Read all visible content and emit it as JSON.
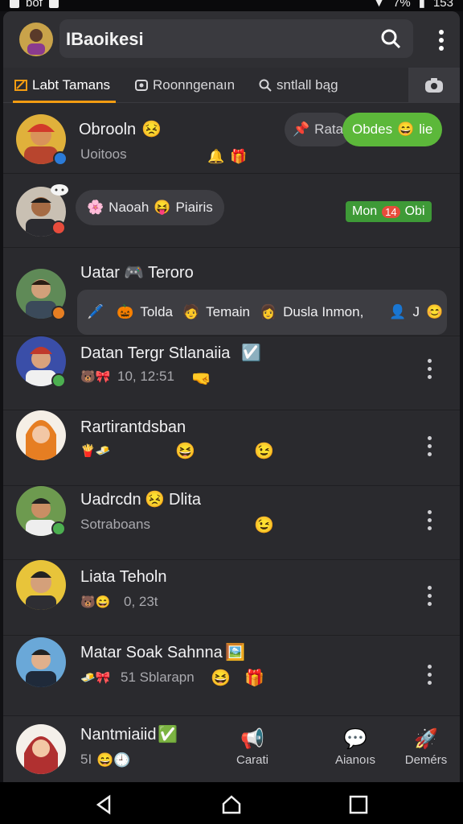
{
  "status": {
    "left_text": "bof",
    "battery": "7%",
    "time": "153"
  },
  "app": {
    "title": "IBaoikesi"
  },
  "tabs": [
    {
      "label": "Labt Tamans",
      "active": true
    },
    {
      "label": "Roonngenaın",
      "active": false
    },
    {
      "label": "sntlall bąg",
      "active": false
    }
  ],
  "chats": [
    {
      "name": "Obrooln",
      "sub": "Uoitoos",
      "pill1": "Rata",
      "pill2": "Obdes",
      "pill2_tail": "lie"
    },
    {
      "name": "",
      "bubble": "Naoah",
      "bubble_tail": "Piairis",
      "tag_left": "Mon",
      "tag_mid": "14",
      "tag_right": "Obi"
    },
    {
      "name": "Uatar",
      "name_tail": "Teroro",
      "chips": [
        "Tolda",
        "Temain",
        "Dusla Inmon,"
      ],
      "chip_end": "J"
    },
    {
      "name": "Datan Tergr Stlanaiia",
      "sub": "10, 12:51"
    },
    {
      "name": "Rartirantdsban",
      "sub": ""
    },
    {
      "name": "Uadrcdn",
      "name_tail": "Dlita",
      "sub": "Sotraboans"
    },
    {
      "name": "Liata Teholn",
      "sub": "0, 23t"
    },
    {
      "name": "Matar Soak Sahnna",
      "sub": "51 Sblarapn"
    },
    {
      "name": "Nantmiaiid",
      "sub": "5I"
    }
  ],
  "dock": [
    {
      "label": "Carati"
    },
    {
      "label": "Aianoıs"
    },
    {
      "label": "Demérs"
    }
  ],
  "colors": {
    "accent": "#f39c12",
    "green": "#4caf50",
    "bg": "#2a2a2e"
  }
}
